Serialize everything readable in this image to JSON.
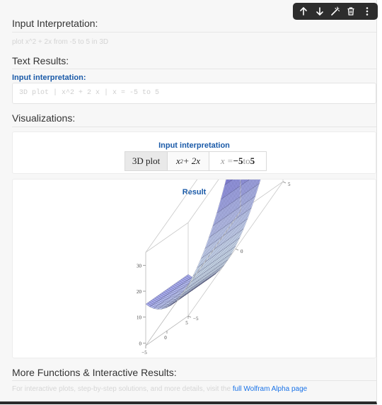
{
  "toolbar": {
    "buttons": [
      {
        "icon": "arrow-up-icon"
      },
      {
        "icon": "arrow-down-icon"
      },
      {
        "icon": "magic-wand-icon"
      },
      {
        "icon": "trash-icon"
      },
      {
        "icon": "more-vertical-icon"
      }
    ]
  },
  "sections": {
    "input_interpretation": {
      "title": "Input Interpretation:",
      "query": "plot x^2 + 2x from -5 to 5 in 3D"
    },
    "text_results": {
      "title": "Text Results:",
      "label": "Input interpretation:",
      "text": "3D plot | x^2 + 2 x | x = -5 to 5"
    },
    "visualizations": {
      "title": "Visualizations:",
      "input_card": {
        "title": "Input interpretation",
        "cell1": "3D plot",
        "cell2_base": "x",
        "cell2_exp": "2",
        "cell2_rest": " + 2x",
        "cell3_prefix": "x = ",
        "cell3_from": "−5",
        "cell3_to_word": " to ",
        "cell3_to": "5"
      },
      "result_card": {
        "title": "Result"
      }
    },
    "more": {
      "title": "More Functions & Interactive Results:",
      "note": "For interactive plots, step-by-step solutions, and more details, visit the ",
      "link": "full Wolfram Alpha page"
    }
  },
  "colors": {
    "accent_blue": "#1a5aa8",
    "link_blue": "#1a73e8",
    "surface_light": "#dff0fb",
    "surface_dark": "#4e3fd0",
    "toolbar_bg": "#2d2d2d"
  },
  "chart_data": {
    "type": "surface3d",
    "title": "Result",
    "function": "x^2 + 2x",
    "x_range": [
      -5,
      5
    ],
    "y_range": [
      -5,
      5
    ],
    "z_ticks": [
      0,
      10,
      20,
      30
    ],
    "x_ticks": [
      -5,
      0,
      5
    ],
    "y_ticks": [
      -5,
      0,
      5
    ],
    "z_range": [
      -1,
      35
    ]
  }
}
